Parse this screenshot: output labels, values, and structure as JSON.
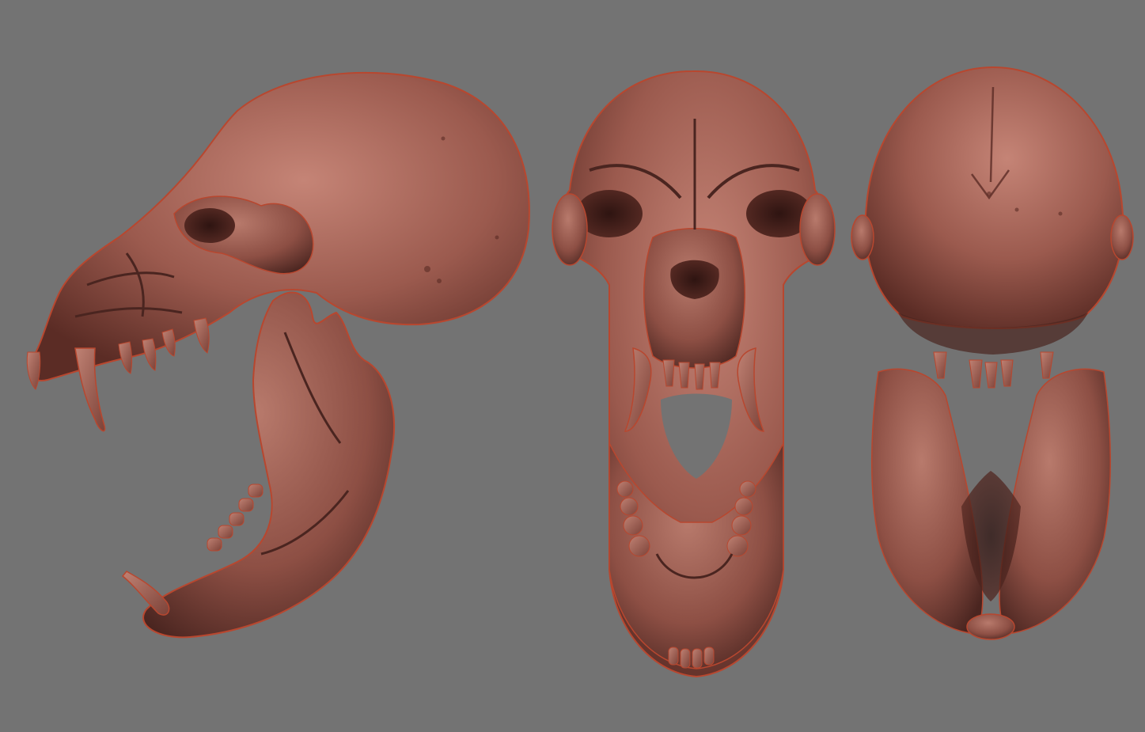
{
  "scene": {
    "background": "#737373",
    "material": {
      "base": "#9b5a4e",
      "highlight": "#c58476",
      "shadow": "#4a2520",
      "rim": "#b8472f",
      "tooth": "#a86658"
    },
    "views": [
      {
        "id": "side",
        "depicts": "skull-side-view"
      },
      {
        "id": "front",
        "depicts": "skull-front-view"
      },
      {
        "id": "back",
        "depicts": "skull-back-view"
      }
    ]
  }
}
